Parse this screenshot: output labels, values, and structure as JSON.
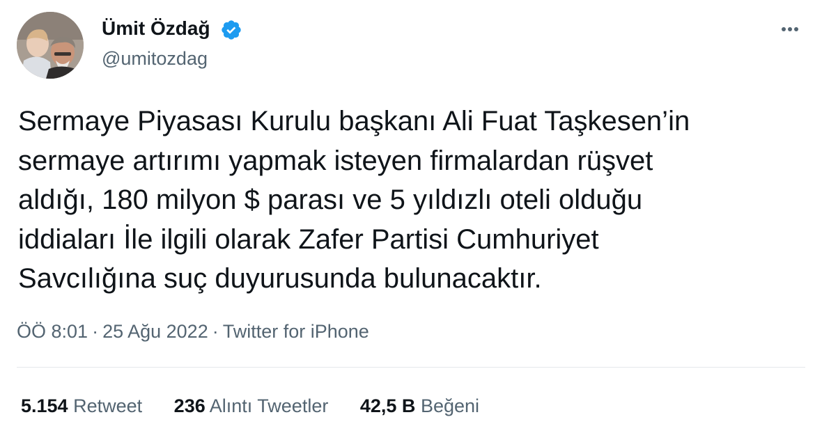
{
  "author": {
    "display_name": "Ümit Özdağ",
    "handle": "@umitozdag",
    "verified": true,
    "avatar": "profile-photo"
  },
  "more_icon": "more-horizontal-icon",
  "tweet": {
    "text": "Sermaye Piyasası Kurulu başkanı Ali Fuat Taşkesen’in\nsermaye artırımı yapmak isteyen firmalardan rüşvet\naldığı, 180 milyon $ parası ve 5 yıldızlı oteli olduğu\niddiaları İle ilgili olarak Zafer Partisi Cumhuriyet\nSavcılığına suç duyurusunda bulunacaktır."
  },
  "meta": {
    "time": "ÖÖ 8:01",
    "separator": "·",
    "date": "25 Ağu 2022",
    "source": "Twitter for iPhone"
  },
  "stats": [
    {
      "count": "5.154",
      "label": "Retweet"
    },
    {
      "count": "236",
      "label": "Alıntı Tweetler"
    },
    {
      "count": "42,5 B",
      "label": "Beğeni"
    }
  ],
  "colors": {
    "text": "#0f1419",
    "secondary": "#536471",
    "verified": "#1d9bf0",
    "divider": "#e4e8eb"
  }
}
